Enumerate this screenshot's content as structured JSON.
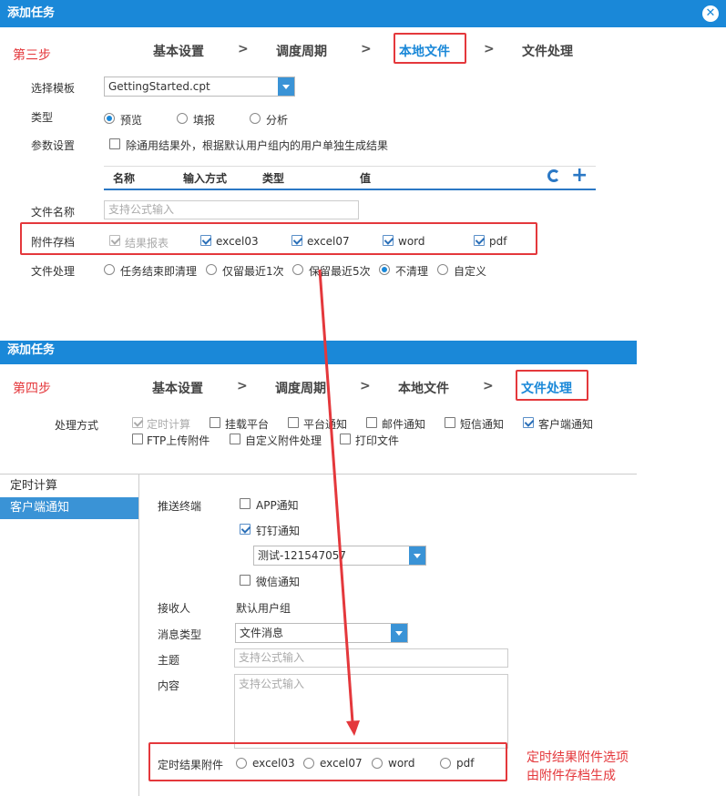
{
  "top": {
    "title": "添加任务",
    "close": "✕",
    "step_label": "第三步",
    "steps": [
      "基本设置",
      "调度周期",
      "本地文件",
      "文件处理"
    ],
    "sep": ">",
    "template_label": "选择模板",
    "template_value": "GettingStarted.cpt",
    "type_label": "类型",
    "type_options": [
      "预览",
      "填报",
      "分析"
    ],
    "param_label": "参数设置",
    "param_checkbox": "除通用结果外，根据默认用户组内的用户单独生成结果",
    "columns": [
      "名称",
      "输入方式",
      "类型",
      "值"
    ],
    "filename_label": "文件名称",
    "filename_placeholder": "支持公式输入",
    "attach_label": "附件存档",
    "attach_options": [
      "结果报表",
      "excel03",
      "excel07",
      "word",
      "pdf"
    ],
    "fileproc_label": "文件处理",
    "fileproc_options": [
      "任务结束即清理",
      "仅留最近1次",
      "保留最近5次",
      "不清理",
      "自定义"
    ]
  },
  "bottom": {
    "title": "添加任务",
    "step_label": "第四步",
    "steps": [
      "基本设置",
      "调度周期",
      "本地文件",
      "文件处理"
    ],
    "sep": ">",
    "method_label": "处理方式",
    "methods": [
      "定时计算",
      "挂载平台",
      "平台通知",
      "邮件通知",
      "短信通知",
      "客户端通知",
      "FTP上传附件",
      "自定义附件处理",
      "打印文件"
    ],
    "side_items": [
      "定时计算",
      "客户端通知"
    ],
    "push_label": "推送终端",
    "app_notify": "APP通知",
    "dingtalk_notify": "钉钉通知",
    "dingtalk_select": "测试-121547057",
    "wechat_notify": "微信通知",
    "receiver_label": "接收人",
    "receiver_value": "默认用户组",
    "msgtype_label": "消息类型",
    "msgtype_value": "文件消息",
    "subject_label": "主题",
    "subject_placeholder": "支持公式输入",
    "content_label": "内容",
    "content_placeholder": "支持公式输入",
    "attach_label": "定时结果附件",
    "attach_options": [
      "excel03",
      "excel07",
      "word",
      "pdf"
    ]
  },
  "note": "定时结果附件选项\n由附件存档生成",
  "colors": {
    "accent": "#1a88d8",
    "annotation": "#e4383c"
  }
}
